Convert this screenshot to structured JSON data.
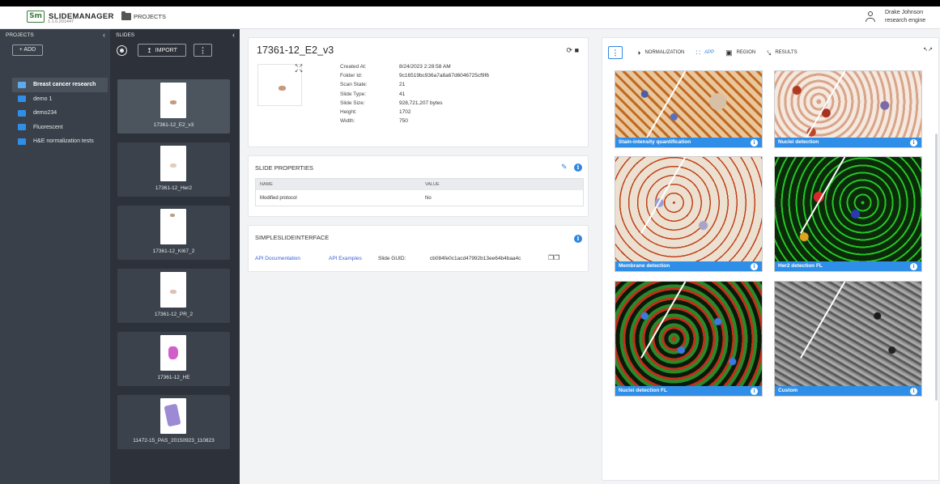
{
  "app": {
    "name": "SLIDEMANAGER",
    "version": "1.1.0.201447",
    "logo_mark": "Sm"
  },
  "topbar": {
    "projects_label": "PROJECTS",
    "user_name": "Drake Johnson",
    "user_role": "research engine"
  },
  "projects_panel": {
    "header": "PROJECTS",
    "add_label": "+ ADD",
    "items": [
      {
        "label": "Breast cancer research",
        "active": true
      },
      {
        "label": "demo 1"
      },
      {
        "label": "demo234"
      },
      {
        "label": "Fluorescent"
      },
      {
        "label": "H&E normalization tests"
      }
    ]
  },
  "slides_panel": {
    "header": "SLIDES",
    "import_label": "IMPORT",
    "slides": [
      {
        "name": "17361-12_E2_v3",
        "active": true
      },
      {
        "name": "17361-12_Her2"
      },
      {
        "name": "17361-12_KI67_2"
      },
      {
        "name": "17361-12_PR_2"
      },
      {
        "name": "17361-12_HE"
      },
      {
        "name": "11472-15_PAS_20150923_110823"
      }
    ]
  },
  "slide_detail": {
    "title": "17361-12_E2_v3",
    "meta": [
      {
        "key": "Created At:",
        "value": "8/24/2023 2:28:58 AM"
      },
      {
        "key": "Folder Id:",
        "value": "9c16519bc936a7a8a67d6046725cf9f6"
      },
      {
        "key": "Scan State:",
        "value": "21"
      },
      {
        "key": "Slide Type:",
        "value": "41"
      },
      {
        "key": "Slide Size:",
        "value": "928,721,207 bytes"
      },
      {
        "key": "Height:",
        "value": "1702"
      },
      {
        "key": "Width:",
        "value": "750"
      }
    ]
  },
  "slide_properties": {
    "title": "SLIDE PROPERTIES",
    "columns": [
      "NAME",
      "VALUE"
    ],
    "rows": [
      {
        "name": "Modified protocol",
        "value": "No"
      }
    ]
  },
  "simple_interface": {
    "title": "SIMPLESLIDEINTERFACE",
    "api_docs": "API Documentation",
    "api_examples": "API Examples",
    "guid_label": "Slide GUID:",
    "guid_value": "cb084fe0c1acd47992b13ee64b4baa4c"
  },
  "apps_panel": {
    "tabs": [
      {
        "label": "NORMALIZATION",
        "icon": "contrast-icon"
      },
      {
        "label": "APP",
        "icon": "grid-icon",
        "active": true
      },
      {
        "label": "REGION",
        "icon": "region-icon"
      },
      {
        "label": "RESULTS",
        "icon": "results-icon"
      }
    ],
    "apps": [
      {
        "label": "Stain-intensity quantification"
      },
      {
        "label": "Nuclei detection"
      },
      {
        "label": "Membrane detection"
      },
      {
        "label": "Her2 detection FL"
      },
      {
        "label": "Nuclei detection FL"
      },
      {
        "label": "Custom"
      }
    ]
  },
  "colors": {
    "accent": "#2f86e0",
    "projects_bg": "#394049",
    "slides_bg": "#2d323a"
  }
}
